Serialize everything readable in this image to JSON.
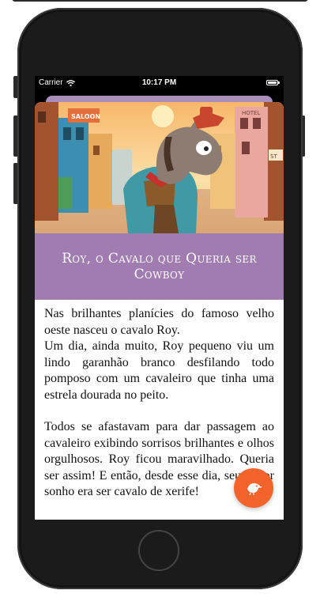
{
  "status_bar": {
    "carrier": "Carrier",
    "time": "10:17 PM"
  },
  "story": {
    "title": "Roy, o Cavalo que Queria ser Cowboy",
    "paragraphs": [
      "Nas brilhantes planícies do famoso velho oeste nasceu o cavalo Roy.",
      "Um dia, ainda muito, Roy pequeno viu um lindo garanhão branco desfilando todo pomposo com um cavaleiro que tinha uma estrela dourada no peito.",
      "Todos se afastavam para dar passagem ao cavaleiro exibindo sorrisos brilhantes e olhos orgulhosos. Roy ficou maravilhado. Queria ser assim! E então, desde esse dia, seu maior sonho era ser cavalo de xerife!"
    ]
  },
  "hero_image": {
    "building_signs": [
      "SALOON",
      "HOTEL",
      "ST"
    ]
  },
  "fab": {
    "icon": "bird-icon"
  },
  "colors": {
    "title_band": "#a07cb0",
    "fab": "#f4632b",
    "phone_frame": "#1b1b1b"
  }
}
